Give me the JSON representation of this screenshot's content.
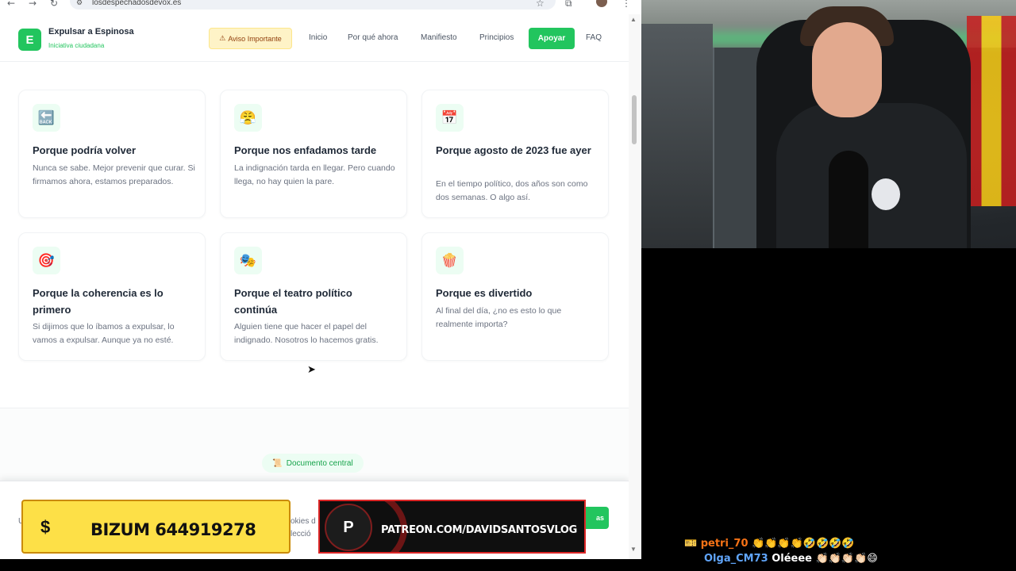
{
  "browser": {
    "url": "losdespechadosdevox.es",
    "nav_icons": {
      "back": "←",
      "forward": "→",
      "reload": "↻"
    },
    "right_icons": {
      "star": "☆",
      "extensions": "⧉",
      "menu": "⋮"
    }
  },
  "header": {
    "logo_letter": "E",
    "brand_title": "Expulsar a Espinosa",
    "brand_subtitle": "Iniciativa ciudadana",
    "warning_icon": "⚠",
    "warning_label": "Aviso Importante",
    "nav": [
      "Inicio",
      "Por qué ahora",
      "Manifiesto",
      "Principios"
    ],
    "cta_label": "Apoyar",
    "faq_label": "FAQ"
  },
  "cards": [
    {
      "icon": "🔙",
      "icon_name": "back-arrow-icon",
      "title": "Porque podría volver",
      "text": "Nunca se sabe. Mejor prevenir que curar. Si firmamos ahora, estamos preparados."
    },
    {
      "icon": "😤",
      "icon_name": "angry-face-icon",
      "title": "Porque nos enfadamos tarde",
      "text": "La indignación tarda en llegar. Pero cuando llega, no hay quien la pare."
    },
    {
      "icon": "📅",
      "icon_name": "calendar-icon",
      "title": "Porque agosto de 2023 fue ayer",
      "text": "En el tiempo político, dos años son como dos semanas. O algo así."
    },
    {
      "icon": "🎯",
      "icon_name": "target-icon",
      "title": "Porque la coherencia es lo primero",
      "text": "Si dijimos que lo íbamos a expulsar, lo vamos a expulsar. Aunque ya no esté."
    },
    {
      "icon": "🎭",
      "icon_name": "theater-masks-icon",
      "title": "Porque el teatro político continúa",
      "text": "Alguien tiene que hacer el papel del indignado. Nosotros lo hacemos gratis."
    },
    {
      "icon": "🍿",
      "icon_name": "popcorn-icon",
      "title": "Porque es divertido",
      "text": "Al final del día, ¿no es esto lo que realmente importa?"
    }
  ],
  "document_pill": {
    "icon": "📜",
    "label": "Documento central"
  },
  "cookie_bar": {
    "fragment_left": "U",
    "fragment_mid_1": "okies d",
    "fragment_mid_2": "lecció",
    "accept_label": "as"
  },
  "overlays": {
    "bizum_symbol": "$",
    "bizum_text": "BIZUM 644919278",
    "patreon_symbol": "P",
    "patreon_text": "PATREON.COM/DAVIDSANTOSVLOG"
  },
  "chat": [
    {
      "prefix": "🎫",
      "user": "petri_70",
      "user_color": "#f97316",
      "message": "👏👏👏👏🤣🤣🤣🤣"
    },
    {
      "prefix": "",
      "user": "Olga_CM73",
      "user_color": "#60a5fa",
      "message": "Oléeee 👏🏻👏🏻👏🏻👏🏻😄"
    }
  ],
  "colors": {
    "accent": "#22c55e",
    "warning_bg": "#fef3c7",
    "bizum_yellow": "#fde047",
    "patreon_red": "#dc2626"
  }
}
